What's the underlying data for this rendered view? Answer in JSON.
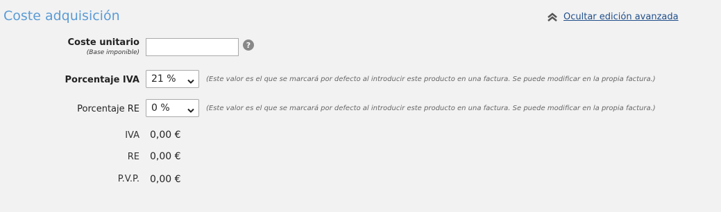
{
  "section": {
    "title": "Coste adquisición",
    "advanced_link": "Ocultar edición avanzada"
  },
  "unit_cost": {
    "label": "Coste unitario",
    "sublabel": "(Base imponible)",
    "value": "",
    "help": "?"
  },
  "iva": {
    "label": "Porcentaje IVA",
    "selected": "21 %",
    "note": "(Este valor es el que se marcará por defecto al introducir este producto en una factura. Se puede modificar en la propia factura.)"
  },
  "re": {
    "label": "Porcentaje RE",
    "selected": "0 %",
    "note": "(Este valor es el que se marcará por defecto al introducir este producto en una factura. Se puede modificar en la propia factura.)"
  },
  "totals": [
    {
      "label": "IVA",
      "value": "0,00 €"
    },
    {
      "label": "RE",
      "value": "0,00 €"
    },
    {
      "label": "P.V.P.",
      "value": "0,00 €"
    }
  ]
}
